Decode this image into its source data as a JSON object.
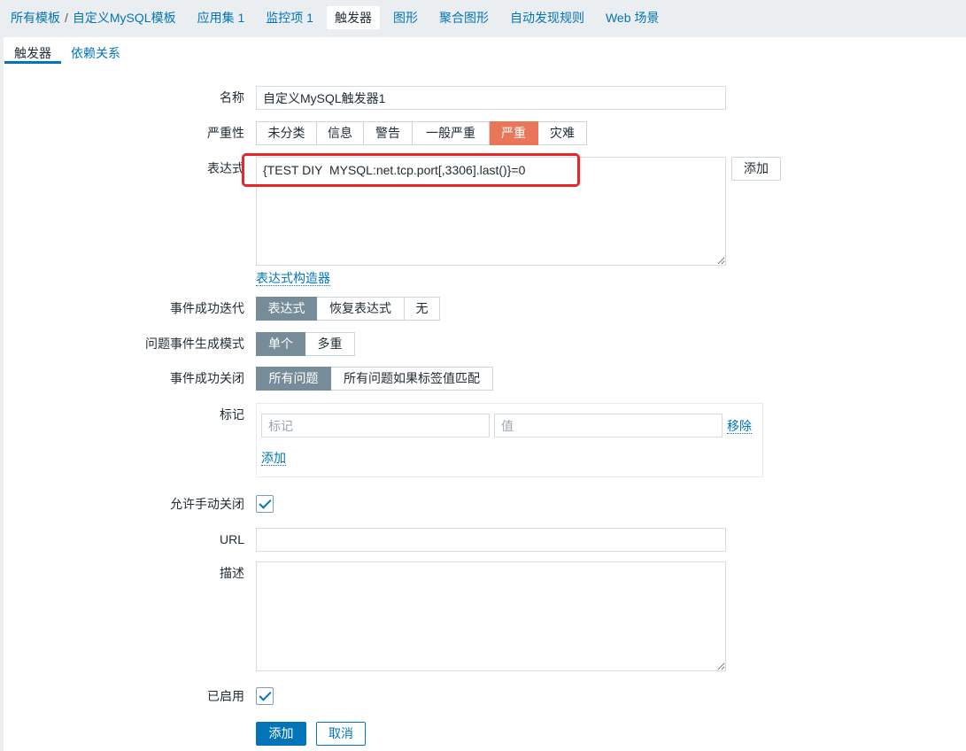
{
  "nav": {
    "breadcrumb": [
      "所有模板",
      "自定义MySQL模板"
    ],
    "separator": "/",
    "items": [
      {
        "label": "应用集 1"
      },
      {
        "label": "监控项 1"
      },
      {
        "label": "触发器",
        "active": true
      },
      {
        "label": "图形"
      },
      {
        "label": "聚合图形"
      },
      {
        "label": "自动发现规则"
      },
      {
        "label": "Web 场景"
      }
    ]
  },
  "tabs": [
    {
      "label": "触发器",
      "active": true
    },
    {
      "label": "依赖关系"
    }
  ],
  "form": {
    "name": {
      "label": "名称",
      "value": "自定义MySQL触发器1"
    },
    "severity": {
      "label": "严重性",
      "options": [
        "未分类",
        "信息",
        "警告",
        "一般严重",
        "严重",
        "灾难"
      ],
      "selected_index": 4
    },
    "expression": {
      "label": "表达式",
      "value": "{TEST DIY  MYSQL:net.tcp.port[,3306].last()}=0",
      "add_button": "添加",
      "builder_link": "表达式构造器"
    },
    "ok_event_generation": {
      "label": "事件成功迭代",
      "options": [
        "表达式",
        "恢复表达式",
        "无"
      ],
      "selected_index": 0
    },
    "problem_mode": {
      "label": "问题事件生成模式",
      "options": [
        "单个",
        "多重"
      ],
      "selected_index": 0
    },
    "ok_event_closes": {
      "label": "事件成功关闭",
      "options": [
        "所有问题",
        "所有问题如果标签值匹配"
      ],
      "selected_index": 0
    },
    "tags": {
      "label": "标记",
      "tag_placeholder": "标记",
      "value_placeholder": "值",
      "remove_link": "移除",
      "add_link": "添加"
    },
    "manual_close": {
      "label": "允许手动关闭",
      "checked": true
    },
    "url": {
      "label": "URL",
      "value": ""
    },
    "description": {
      "label": "描述",
      "value": ""
    },
    "enabled": {
      "label": "已启用",
      "checked": true
    },
    "buttons": {
      "add": "添加",
      "cancel": "取消"
    }
  },
  "colors": {
    "link": "#0275b8",
    "severity_high": "#e97659",
    "segment_active": "#768d99",
    "annotation": "#e8262a"
  }
}
